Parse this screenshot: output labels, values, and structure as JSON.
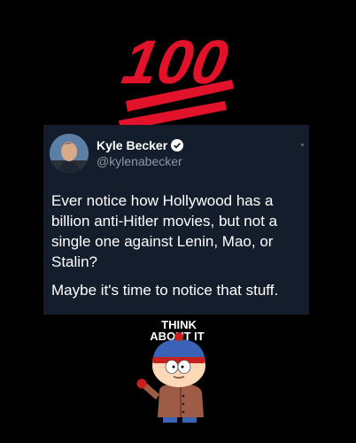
{
  "tweet": {
    "display_name": "Kyle Becker",
    "handle": "@kylenabecker",
    "paragraphs": [
      "Ever notice how Hollywood has a billion anti-Hitler movies, but not a single one against Lenin, Mao, or Stalin?",
      "Maybe it's time to notice that stuff."
    ]
  },
  "sticker": {
    "caption_line1": "THINK",
    "caption_line2": "ABOUT IT"
  },
  "emoji": {
    "hundred_text": "100",
    "color": "#e3122b"
  }
}
